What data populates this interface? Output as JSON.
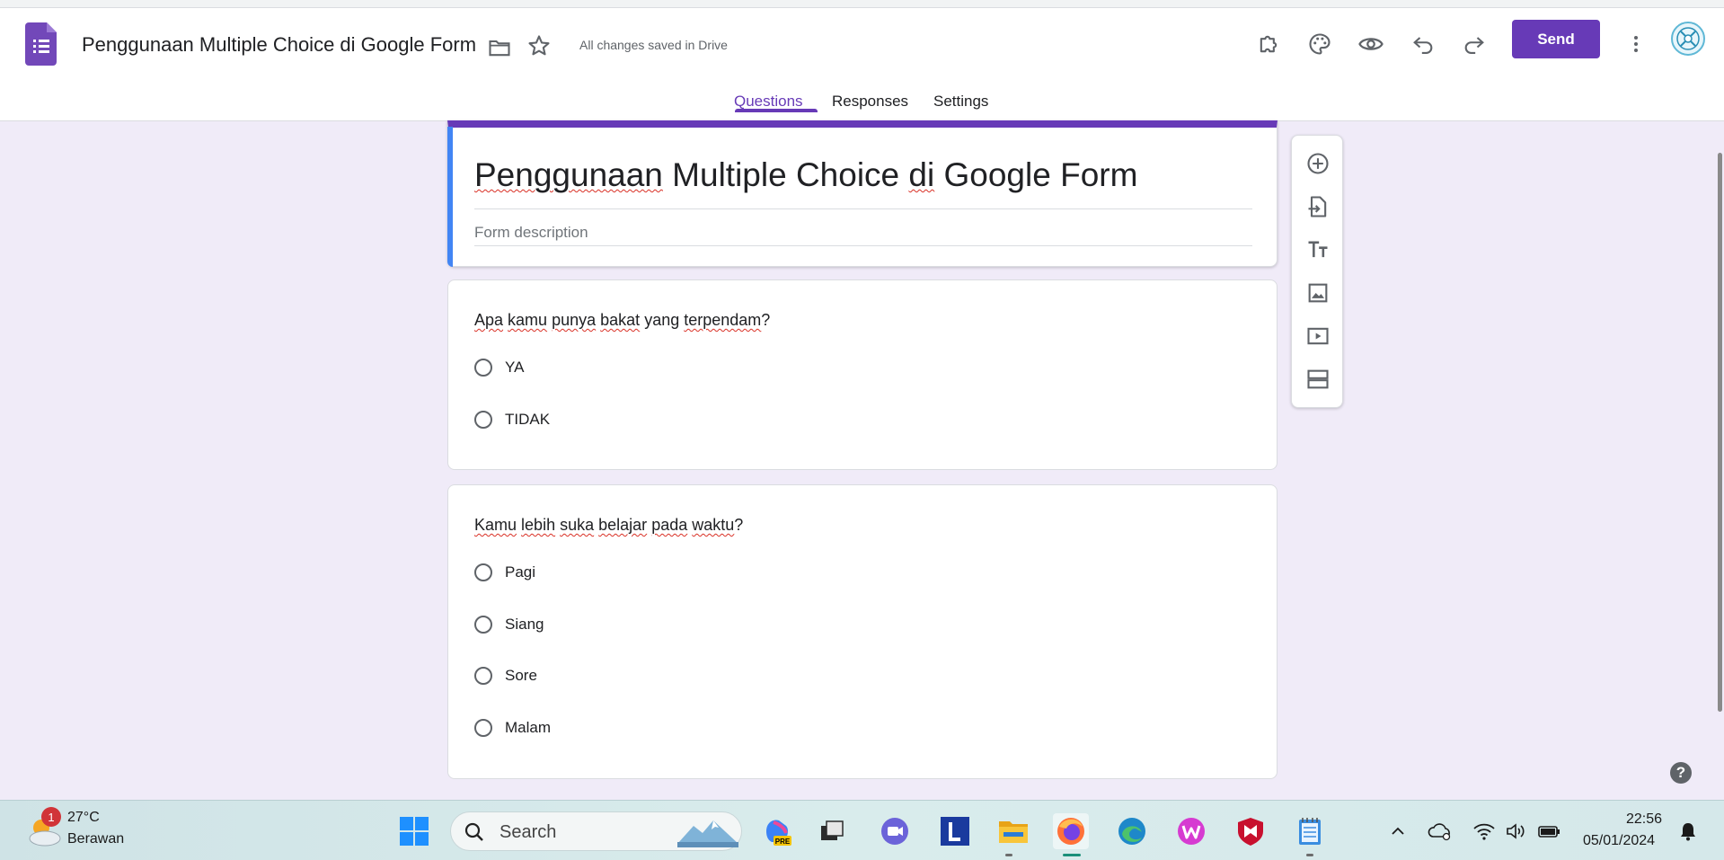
{
  "header": {
    "form_title": "Penggunaan Multiple Choice di Google Form",
    "saved_status": "All changes saved in Drive",
    "send_label": "Send",
    "accent": "#673ab7"
  },
  "tabs": [
    {
      "label": "Questions",
      "active": true
    },
    {
      "label": "Responses",
      "active": false
    },
    {
      "label": "Settings",
      "active": false
    }
  ],
  "form": {
    "title_words": [
      "Penggunaan",
      "Multiple Choice",
      "di",
      "Google Form"
    ],
    "description_placeholder": "Form description"
  },
  "questions": [
    {
      "title_parts": [
        "Apa",
        " ",
        "kamu",
        " ",
        "punya",
        " ",
        "bakat",
        " yang ",
        "terpendam",
        "?"
      ],
      "options": [
        "YA",
        "TIDAK"
      ]
    },
    {
      "title_parts": [
        "Kamu",
        " ",
        "lebih",
        " ",
        "suka",
        " ",
        "belajar",
        " ",
        "pada",
        " ",
        "waktu",
        "?"
      ],
      "options": [
        "Pagi",
        "Siang",
        "Sore",
        "Malam"
      ]
    }
  ],
  "side_toolbar": [
    "add-question-icon",
    "import-questions-icon",
    "add-title-icon",
    "add-image-icon",
    "add-video-icon",
    "add-section-icon"
  ],
  "help_label": "?",
  "taskbar": {
    "weather_temp": "27°C",
    "weather_desc": "Berawan",
    "weather_badge": "1",
    "search_placeholder": "Search",
    "time": "22:56",
    "date": "05/01/2024"
  }
}
